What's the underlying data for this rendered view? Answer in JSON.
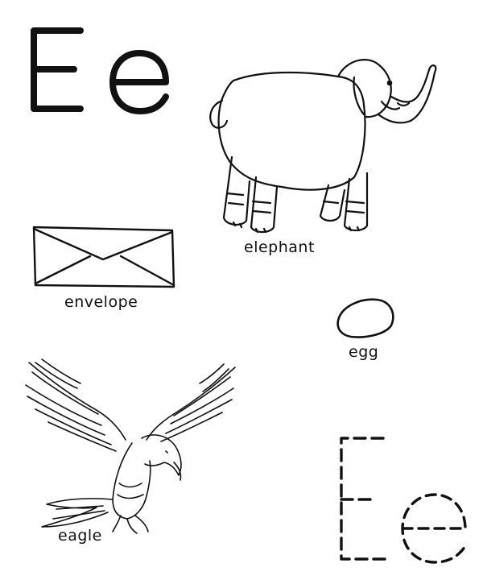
{
  "worksheet": {
    "letter_upper": "E",
    "letter_lower": "e",
    "items": [
      {
        "word": "elephant",
        "picture": "elephant-drawing"
      },
      {
        "word": "envelope",
        "picture": "envelope-drawing"
      },
      {
        "word": "egg",
        "picture": "egg-drawing"
      },
      {
        "word": "eagle",
        "picture": "eagle-drawing"
      }
    ],
    "tracing": {
      "upper": "E",
      "lower": "e",
      "style": "dashed"
    },
    "colors": {
      "ink": "#111111",
      "background": "#ffffff"
    }
  }
}
